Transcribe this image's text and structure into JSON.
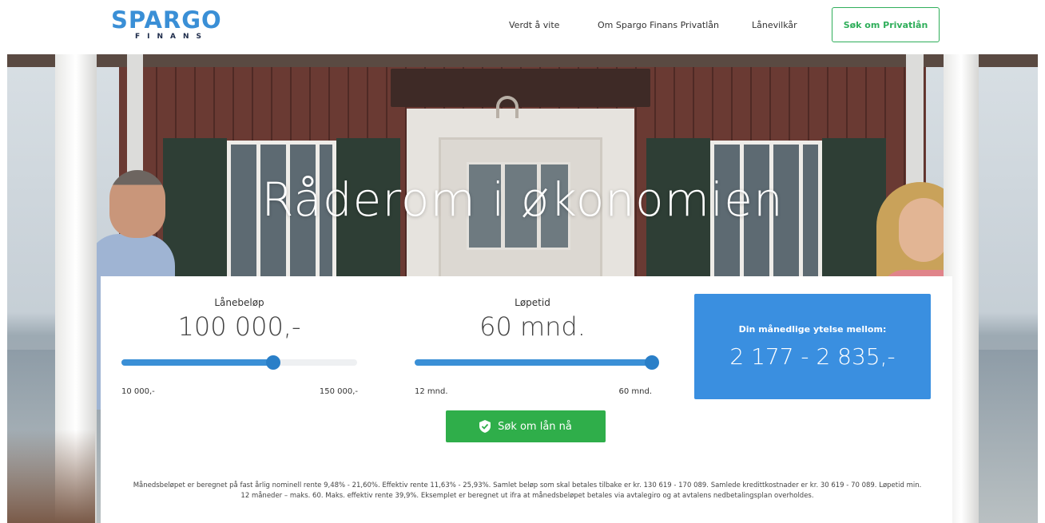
{
  "header": {
    "logo_main": "SPARGO",
    "logo_sub": "FINANS",
    "nav": [
      {
        "label": "Verdt å vite"
      },
      {
        "label": "Om Spargo Finans Privatlån"
      },
      {
        "label": "Lånevilkår"
      }
    ],
    "cta_label": "Søk om Privatlån"
  },
  "hero": {
    "title": "Råderom i økonomien"
  },
  "calculator": {
    "amount": {
      "label": "Lånebeløp",
      "value": "100 000,-",
      "min_label": "10 000,-",
      "max_label": "150 000,-",
      "min": 10000,
      "max": 150000,
      "current": 100000
    },
    "term": {
      "label": "Løpetid",
      "value": "60 mnd.",
      "min_label": "12 mnd.",
      "max_label": "60 mnd.",
      "min": 12,
      "max": 60,
      "current": 60
    },
    "result": {
      "label": "Din månedlige ytelse mellom:",
      "value": "2 177 - 2 835,-"
    },
    "cta_label": "Søk om lån nå",
    "disclaimer": "Månedsbeløpet er beregnet på fast årlig nominell rente 9,48% - 21,60%. Effektiv rente 11,63% - 25,93%. Samlet beløp som skal betales tilbake er kr. 130 619 - 170 089. Samlede kredittkostnader er kr. 30 619 - 70 089. Løpetid min. 12 måneder – maks. 60. Maks. effektiv rente 39,9%. Eksemplet er beregnet ut ifra at månedsbeløpet betales via avtalegiro og at avtalens nedbetalingsplan overholdes."
  },
  "colors": {
    "brand_blue": "#3a8fd6",
    "result_blue": "#3a8fe0",
    "cta_green": "#2fae4a"
  },
  "icons": {
    "cta_icon": "shield-check-icon"
  }
}
